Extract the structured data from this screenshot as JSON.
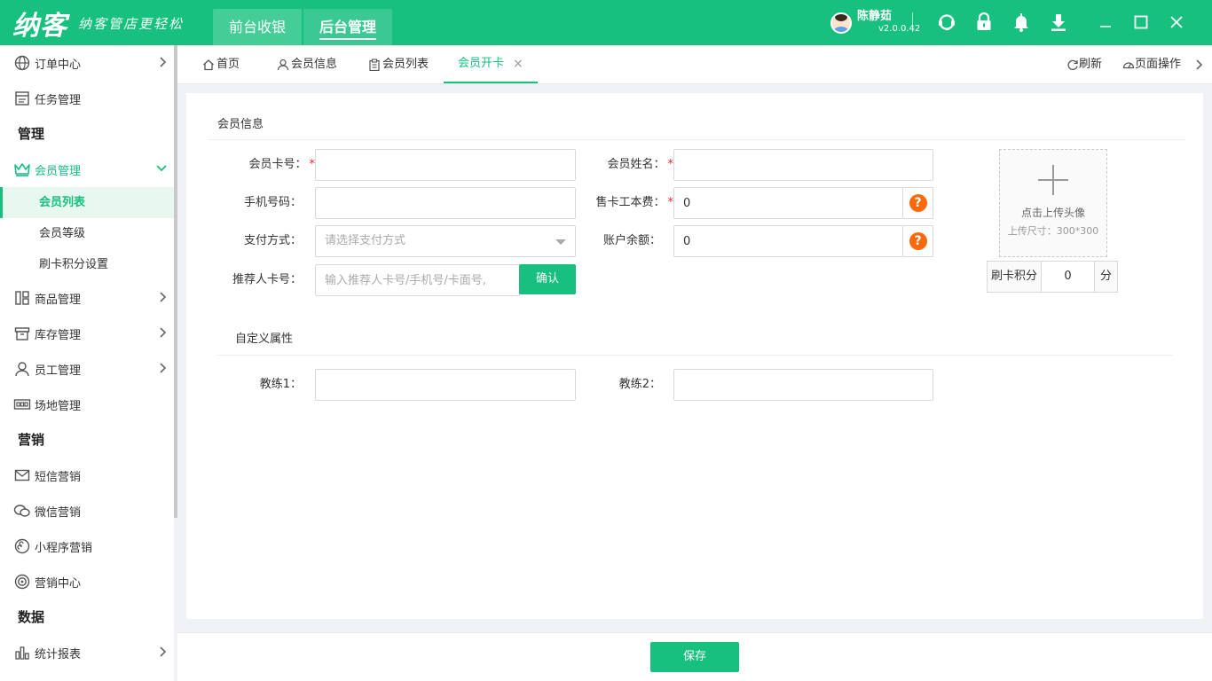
{
  "header": {
    "logo": "纳客",
    "slogan": "纳客管店更轻松",
    "tabs": [
      {
        "label": "前台收银"
      },
      {
        "label": "后台管理"
      }
    ],
    "user_name": "陈静茹",
    "version": "v2.0.0.42",
    "icons": [
      "headset-icon",
      "lock-icon",
      "bell-icon",
      "download-icon"
    ],
    "window_controls": [
      "minimize-icon",
      "maximize-icon",
      "close-icon"
    ]
  },
  "sidebar": {
    "items": [
      {
        "type": "item",
        "label": "订单中心",
        "icon": "globe-icon",
        "chevron": true
      },
      {
        "type": "item",
        "label": "任务管理",
        "icon": "task-icon",
        "chevron": false
      },
      {
        "type": "head",
        "label": "管理"
      },
      {
        "type": "item",
        "label": "会员管理",
        "icon": "crown-icon",
        "chevron": true,
        "open": true
      },
      {
        "type": "sub",
        "label": "会员列表",
        "active": true
      },
      {
        "type": "sub",
        "label": "会员等级"
      },
      {
        "type": "sub",
        "label": "刷卡积分设置"
      },
      {
        "type": "item",
        "label": "商品管理",
        "icon": "goods-icon",
        "chevron": true
      },
      {
        "type": "item",
        "label": "库存管理",
        "icon": "inventory-icon",
        "chevron": true
      },
      {
        "type": "item",
        "label": "员工管理",
        "icon": "staff-icon",
        "chevron": true
      },
      {
        "type": "item",
        "label": "场地管理",
        "icon": "venue-icon",
        "chevron": false
      },
      {
        "type": "head",
        "label": "营销"
      },
      {
        "type": "item",
        "label": "短信营销",
        "icon": "mail-icon",
        "chevron": false
      },
      {
        "type": "item",
        "label": "微信营销",
        "icon": "wechat-icon",
        "chevron": false
      },
      {
        "type": "item",
        "label": "小程序营销",
        "icon": "miniprogram-icon",
        "chevron": false
      },
      {
        "type": "item",
        "label": "营销中心",
        "icon": "target-icon",
        "chevron": false
      },
      {
        "type": "head",
        "label": "数据"
      },
      {
        "type": "item",
        "label": "统计报表",
        "icon": "chart-icon",
        "chevron": true
      }
    ]
  },
  "tabs": {
    "home": "首页",
    "member_info": "会员信息",
    "member_list": "会员列表",
    "open_card": "会员开卡",
    "close": "×",
    "refresh": "刷新",
    "page_ops": "页面操作"
  },
  "form": {
    "section_member": "会员信息",
    "card_no_label": "会员卡号：",
    "name_label": "会员姓名：",
    "phone_label": "手机号码：",
    "fee_label": "售卡工本费：",
    "fee_value": "0",
    "pay_label": "支付方式：",
    "pay_placeholder": "请选择支付方式",
    "balance_label": "账户余额：",
    "balance_value": "0",
    "referrer_label": "推荐人卡号：",
    "referrer_placeholder": "输入推荐人卡号/手机号/卡面号,",
    "confirm": "确认",
    "required_mark": "*",
    "help_mark": "?",
    "upload_text": "点击上传头像",
    "upload_size": "上传尺寸：300*300",
    "points_label": "刷卡积分",
    "points_value": "0",
    "points_unit": "分",
    "section_custom": "自定义属性",
    "coach1_label": "教练1：",
    "coach2_label": "教练2："
  },
  "footer": {
    "save": "保存"
  },
  "colors": {
    "primary": "#17c07f",
    "help": "#fa6a0a",
    "required": "#f5222d"
  }
}
